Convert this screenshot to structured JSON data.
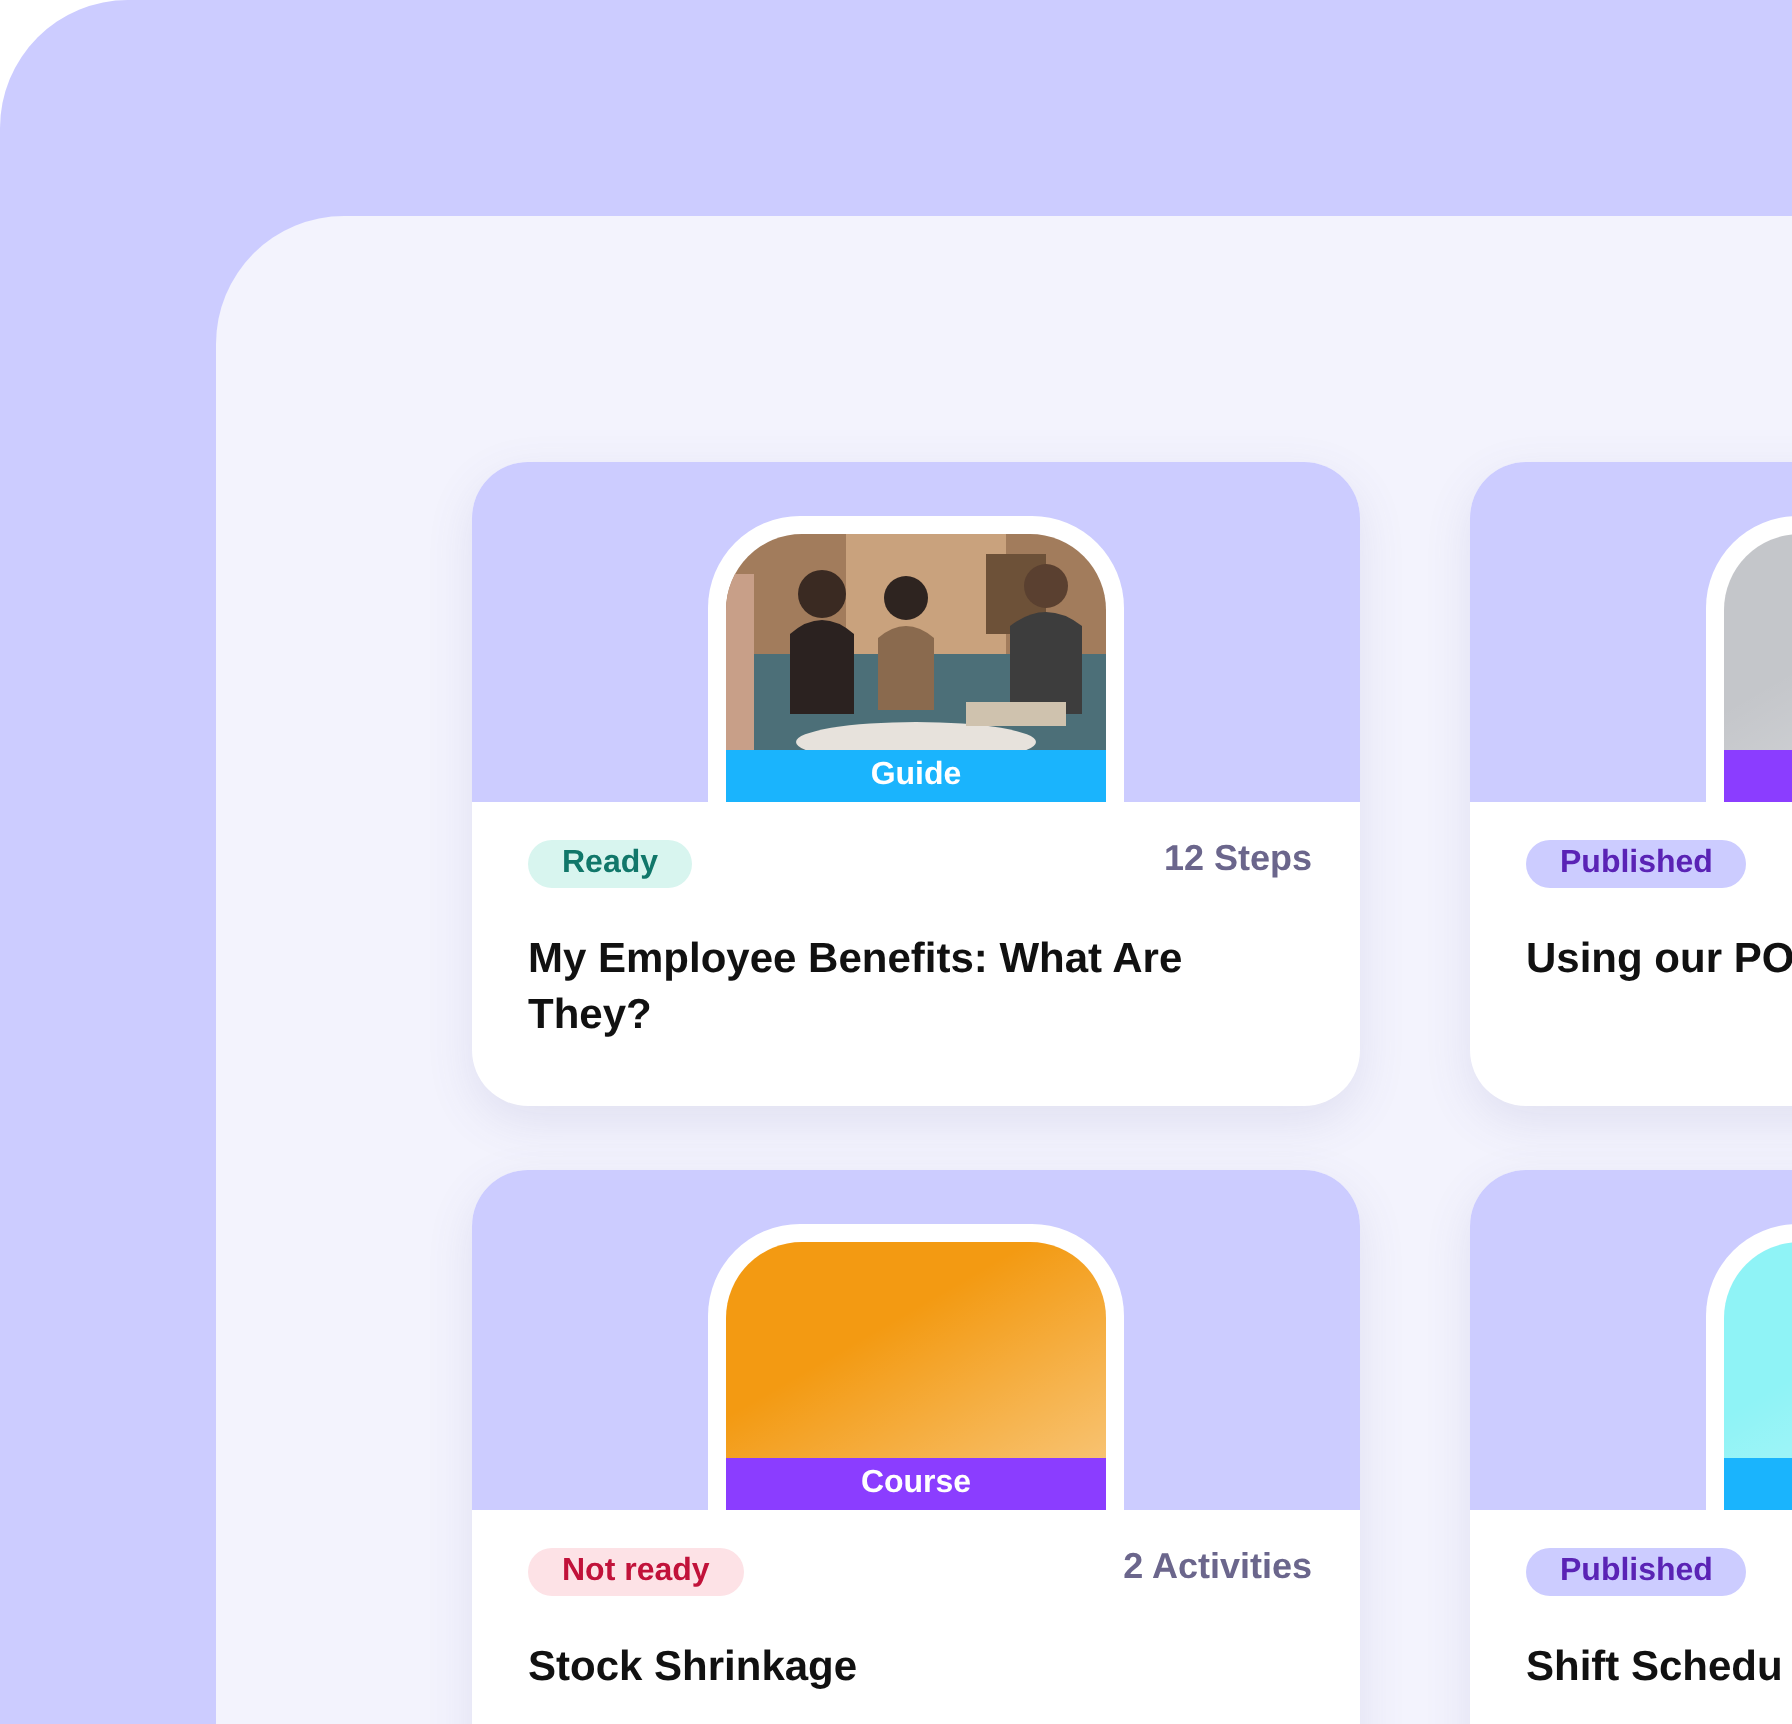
{
  "cards": [
    {
      "strip": {
        "label": "Guide",
        "color": "#1ab4fd"
      },
      "status": {
        "label": "Ready",
        "kind": "ready"
      },
      "meta": "12 Steps",
      "title": "My Employee Benefits: What Are They?"
    },
    {
      "cover": {
        "kind": "gradient",
        "color": "#c4c6ca"
      },
      "strip": {
        "color": "#8b3dff"
      },
      "status": {
        "label": "Published",
        "kind": "published"
      },
      "title": "Using our PO"
    },
    {
      "cover": {
        "kind": "gradient",
        "color": "#f39a12"
      },
      "strip": {
        "label": "Course",
        "color": "#8b3dff"
      },
      "status": {
        "label": "Not ready",
        "kind": "not_ready"
      },
      "meta": "2 Activities",
      "title": "Stock Shrinkage"
    },
    {
      "cover": {
        "kind": "gradient",
        "color": "#8ff3f6"
      },
      "strip": {
        "color": "#1ab4fd"
      },
      "status": {
        "label": "Published",
        "kind": "published"
      },
      "title": "Shift Schedu"
    }
  ]
}
